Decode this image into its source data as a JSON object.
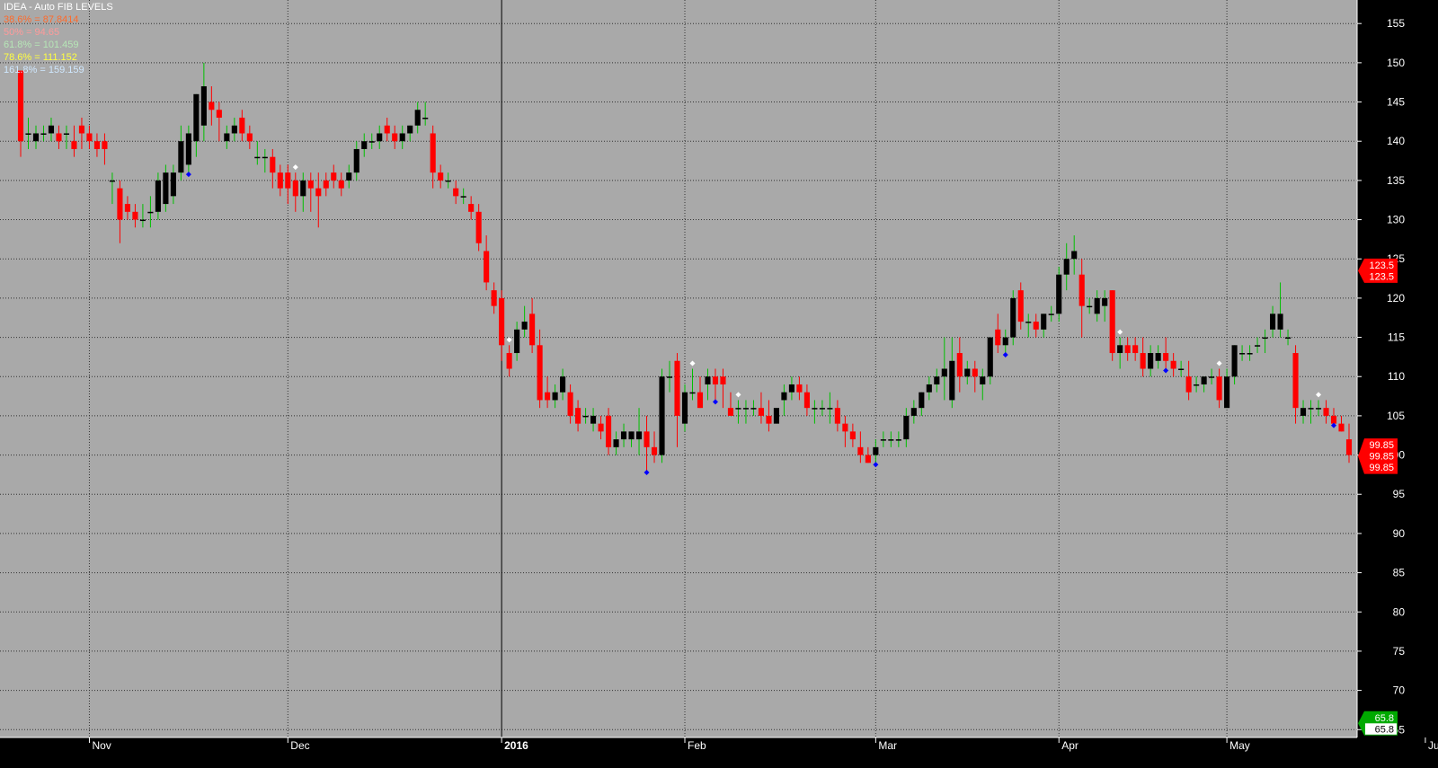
{
  "header": {
    "title": "IDEA - Auto FIB LEVELS",
    "fib_levels": [
      {
        "text": "38.6% = 87.8414",
        "color": "#ff6a2a"
      },
      {
        "text": "50% = 94.65",
        "color": "#ff9a9a"
      },
      {
        "text": "61.8% = 101.459",
        "color": "#b6e6b6"
      },
      {
        "text": "78.6% = 111.152",
        "color": "#ffff40"
      },
      {
        "text": "161.8% = 159.159",
        "color": "#cfe8ff"
      }
    ]
  },
  "colors": {
    "plot_bg": "#a9a9a9",
    "axis_bg": "#000000",
    "up_candle": "#000000",
    "down_candle": "#ff0000",
    "wick_up": "#00c000",
    "wick_down": "#ff0000",
    "grid": "#333333",
    "signal_top": "#ffffff",
    "signal_bottom": "#0000ff"
  },
  "chart_data": {
    "type": "candlestick",
    "symbol": "IDEA",
    "title": "IDEA - Auto FIB LEVELS",
    "y_ticks": [
      155,
      150,
      145,
      140,
      135,
      130,
      125,
      120,
      115,
      110,
      105,
      100,
      95,
      90,
      85,
      80,
      75,
      70,
      65
    ],
    "ylim": [
      64,
      158
    ],
    "x_labels": [
      {
        "label": "Nov",
        "index": 9
      },
      {
        "label": "Dec",
        "index": 35
      },
      {
        "label": "2016",
        "index": 63
      },
      {
        "label": "Feb",
        "index": 87
      },
      {
        "label": "Mar",
        "index": 112
      },
      {
        "label": "Apr",
        "index": 136
      },
      {
        "label": "May",
        "index": 158
      },
      {
        "label": "Jun",
        "index": 184
      }
    ],
    "year_divider_index": 63,
    "candles": [
      [
        149,
        149,
        138,
        140
      ],
      [
        141,
        143,
        139,
        141
      ],
      [
        140,
        142,
        139,
        141
      ],
      [
        141,
        142,
        140,
        141
      ],
      [
        141,
        143,
        140,
        142
      ],
      [
        141,
        142,
        139,
        140
      ],
      [
        141,
        142,
        139,
        141
      ],
      [
        140,
        142,
        138,
        139
      ],
      [
        142,
        143,
        139,
        141
      ],
      [
        141,
        142,
        139,
        140
      ],
      [
        140,
        141,
        138,
        139
      ],
      [
        140,
        141,
        137,
        139
      ],
      [
        135,
        136,
        132,
        135
      ],
      [
        134,
        135,
        127,
        130
      ],
      [
        132,
        133,
        130,
        131
      ],
      [
        131,
        132,
        129,
        130
      ],
      [
        130,
        132,
        129,
        130
      ],
      [
        131,
        133,
        129,
        131
      ],
      [
        131,
        136,
        130,
        135
      ],
      [
        132,
        137,
        131,
        136
      ],
      [
        133,
        137,
        132,
        136
      ],
      [
        136,
        142,
        135,
        140
      ],
      [
        137,
        142,
        136,
        141
      ],
      [
        140,
        146,
        138,
        146
      ],
      [
        142,
        150,
        140,
        147
      ],
      [
        145,
        147,
        142,
        144
      ],
      [
        144,
        145,
        140,
        143
      ],
      [
        140,
        142,
        139,
        141
      ],
      [
        141,
        143,
        140,
        142
      ],
      [
        143,
        144,
        140,
        141
      ],
      [
        141,
        142,
        139,
        140
      ],
      [
        138,
        140,
        137,
        138
      ],
      [
        138,
        139,
        136,
        138
      ],
      [
        138,
        139,
        134,
        136
      ],
      [
        136,
        137,
        133,
        134
      ],
      [
        136,
        137,
        132,
        134
      ],
      [
        135,
        136,
        131,
        133
      ],
      [
        133,
        136,
        131,
        135
      ],
      [
        135,
        136,
        131,
        134
      ],
      [
        134,
        136,
        129,
        133
      ],
      [
        135,
        136,
        133,
        134
      ],
      [
        136,
        137,
        134,
        135
      ],
      [
        135,
        136,
        133,
        134
      ],
      [
        135,
        137,
        134,
        136
      ],
      [
        136,
        140,
        135,
        139
      ],
      [
        139,
        141,
        138,
        140
      ],
      [
        140,
        141,
        139,
        140
      ],
      [
        140,
        142,
        139,
        141
      ],
      [
        142,
        143,
        140,
        141
      ],
      [
        141,
        142,
        139,
        140
      ],
      [
        140,
        142,
        139,
        141
      ],
      [
        141,
        142,
        140,
        142
      ],
      [
        142,
        145,
        141,
        144
      ],
      [
        143,
        145,
        142,
        143
      ],
      [
        141,
        142,
        134,
        136
      ],
      [
        136,
        137,
        134,
        135
      ],
      [
        135,
        136,
        134,
        135
      ],
      [
        134,
        135,
        132,
        133
      ],
      [
        133,
        134,
        132,
        133
      ],
      [
        132,
        133,
        130,
        131
      ],
      [
        131,
        132,
        126,
        127
      ],
      [
        126,
        128,
        121,
        122
      ],
      [
        121,
        122,
        118,
        119
      ],
      [
        120,
        121,
        112,
        114
      ],
      [
        113,
        114,
        110,
        111
      ],
      [
        113,
        117,
        112,
        116
      ],
      [
        116,
        119,
        115,
        117
      ],
      [
        118,
        120,
        113,
        114
      ],
      [
        114,
        116,
        106,
        107
      ],
      [
        108,
        110,
        106,
        107
      ],
      [
        107,
        109,
        106,
        108
      ],
      [
        108,
        111,
        107,
        110
      ],
      [
        108,
        109,
        104,
        105
      ],
      [
        106,
        107,
        103,
        104
      ],
      [
        105,
        106,
        104,
        105
      ],
      [
        104,
        106,
        103,
        105
      ],
      [
        104,
        105,
        102,
        103
      ],
      [
        105,
        106,
        100,
        101
      ],
      [
        101,
        103,
        100,
        102
      ],
      [
        102,
        104,
        101,
        103
      ],
      [
        102,
        103,
        101,
        103
      ],
      [
        102,
        106,
        100,
        103
      ],
      [
        103,
        105,
        98,
        101
      ],
      [
        101,
        103,
        99,
        100
      ],
      [
        100,
        111,
        99,
        110
      ],
      [
        110,
        112,
        108,
        110
      ],
      [
        112,
        113,
        101,
        105
      ],
      [
        104,
        109,
        103,
        108
      ],
      [
        108,
        111,
        107,
        108
      ],
      [
        108,
        110,
        106,
        106
      ],
      [
        109,
        111,
        107,
        110
      ],
      [
        110,
        111,
        107,
        109
      ],
      [
        110,
        111,
        106,
        109
      ],
      [
        106,
        108,
        105,
        105
      ],
      [
        106,
        107,
        104,
        106
      ],
      [
        106,
        107,
        104,
        106
      ],
      [
        106,
        107,
        105,
        106
      ],
      [
        106,
        108,
        104,
        105
      ],
      [
        105,
        107,
        103,
        104
      ],
      [
        104,
        106,
        104,
        106
      ],
      [
        107,
        109,
        105,
        108
      ],
      [
        108,
        110,
        107,
        109
      ],
      [
        109,
        110,
        107,
        108
      ],
      [
        108,
        109,
        105,
        106
      ],
      [
        106,
        107,
        104,
        106
      ],
      [
        106,
        107,
        105,
        106
      ],
      [
        106,
        108,
        104,
        106
      ],
      [
        106,
        107,
        103,
        104
      ],
      [
        104,
        105,
        101,
        103
      ],
      [
        103,
        104,
        101,
        102
      ],
      [
        101,
        103,
        99,
        100
      ],
      [
        100,
        101,
        99,
        99
      ],
      [
        100,
        102,
        99,
        101
      ],
      [
        102,
        103,
        101,
        102
      ],
      [
        102,
        103,
        101,
        102
      ],
      [
        102,
        103,
        101,
        102
      ],
      [
        102,
        106,
        101,
        105
      ],
      [
        105,
        107,
        104,
        106
      ],
      [
        106,
        108,
        105,
        108
      ],
      [
        108,
        110,
        107,
        109
      ],
      [
        109,
        111,
        108,
        110
      ],
      [
        110,
        115,
        107,
        111
      ],
      [
        107,
        115,
        106,
        112
      ],
      [
        113,
        115,
        108,
        110
      ],
      [
        110,
        112,
        109,
        111
      ],
      [
        111,
        112,
        108,
        110
      ],
      [
        109,
        111,
        107,
        110
      ],
      [
        110,
        115,
        109,
        115
      ],
      [
        116,
        118,
        113,
        114
      ],
      [
        114,
        116,
        113,
        115
      ],
      [
        115,
        121,
        114,
        120
      ],
      [
        121,
        122,
        116,
        117
      ],
      [
        117,
        118,
        115,
        117
      ],
      [
        117,
        118,
        115,
        116
      ],
      [
        116,
        118,
        115,
        118
      ],
      [
        118,
        119,
        117,
        118
      ],
      [
        118,
        124,
        117,
        123
      ],
      [
        123,
        127,
        121,
        125
      ],
      [
        125,
        128,
        123,
        126
      ],
      [
        123,
        125,
        115,
        119
      ],
      [
        119,
        120,
        118,
        119
      ],
      [
        118,
        121,
        117,
        120
      ],
      [
        119,
        121,
        117,
        120
      ],
      [
        121,
        121,
        112,
        113
      ],
      [
        113,
        115,
        111,
        114
      ],
      [
        114,
        115,
        112,
        113
      ],
      [
        114,
        115,
        112,
        113
      ],
      [
        113,
        115,
        110,
        111
      ],
      [
        111,
        114,
        110,
        113
      ],
      [
        112,
        114,
        111,
        113
      ],
      [
        113,
        115,
        111,
        112
      ],
      [
        112,
        113,
        110,
        111
      ],
      [
        111,
        112,
        110,
        111
      ],
      [
        110,
        112,
        107,
        108
      ],
      [
        109,
        110,
        108,
        109
      ],
      [
        109,
        110,
        108,
        110
      ],
      [
        110,
        111,
        109,
        110
      ],
      [
        110,
        111,
        106,
        107
      ],
      [
        106,
        111,
        106,
        110
      ],
      [
        110,
        114,
        109,
        114
      ],
      [
        113,
        114,
        112,
        113
      ],
      [
        113,
        114,
        112,
        113
      ],
      [
        114,
        115,
        113,
        114
      ],
      [
        115,
        116,
        113,
        115
      ],
      [
        116,
        119,
        115,
        118
      ],
      [
        116,
        122,
        115,
        118
      ],
      [
        115,
        116,
        114,
        115
      ],
      [
        113,
        114,
        104,
        106
      ],
      [
        105,
        107,
        104,
        106
      ],
      [
        106,
        107,
        104,
        106
      ],
      [
        106,
        107,
        105,
        106
      ],
      [
        106,
        107,
        104,
        105
      ],
      [
        105,
        106,
        104,
        104
      ],
      [
        104,
        105,
        103,
        103
      ],
      [
        102,
        104,
        99,
        100
      ]
    ],
    "signals": {
      "top": [
        36,
        64,
        88,
        94,
        144,
        157,
        170,
        176,
        178,
        182,
        215
      ],
      "bottom": [
        22,
        82,
        91,
        112,
        129,
        150,
        172,
        177,
        201
      ]
    },
    "price_tags": [
      {
        "value": 123.5,
        "lines": [
          "123.5",
          "123.5"
        ],
        "color": "#ff0000"
      },
      {
        "value": 99.85,
        "lines": [
          "99.85",
          "99.85",
          "99.85"
        ],
        "color": "#ff0000"
      },
      {
        "value": 65.8,
        "lines": [
          "65.8",
          "65.8"
        ],
        "color": "#00aa00"
      }
    ]
  }
}
